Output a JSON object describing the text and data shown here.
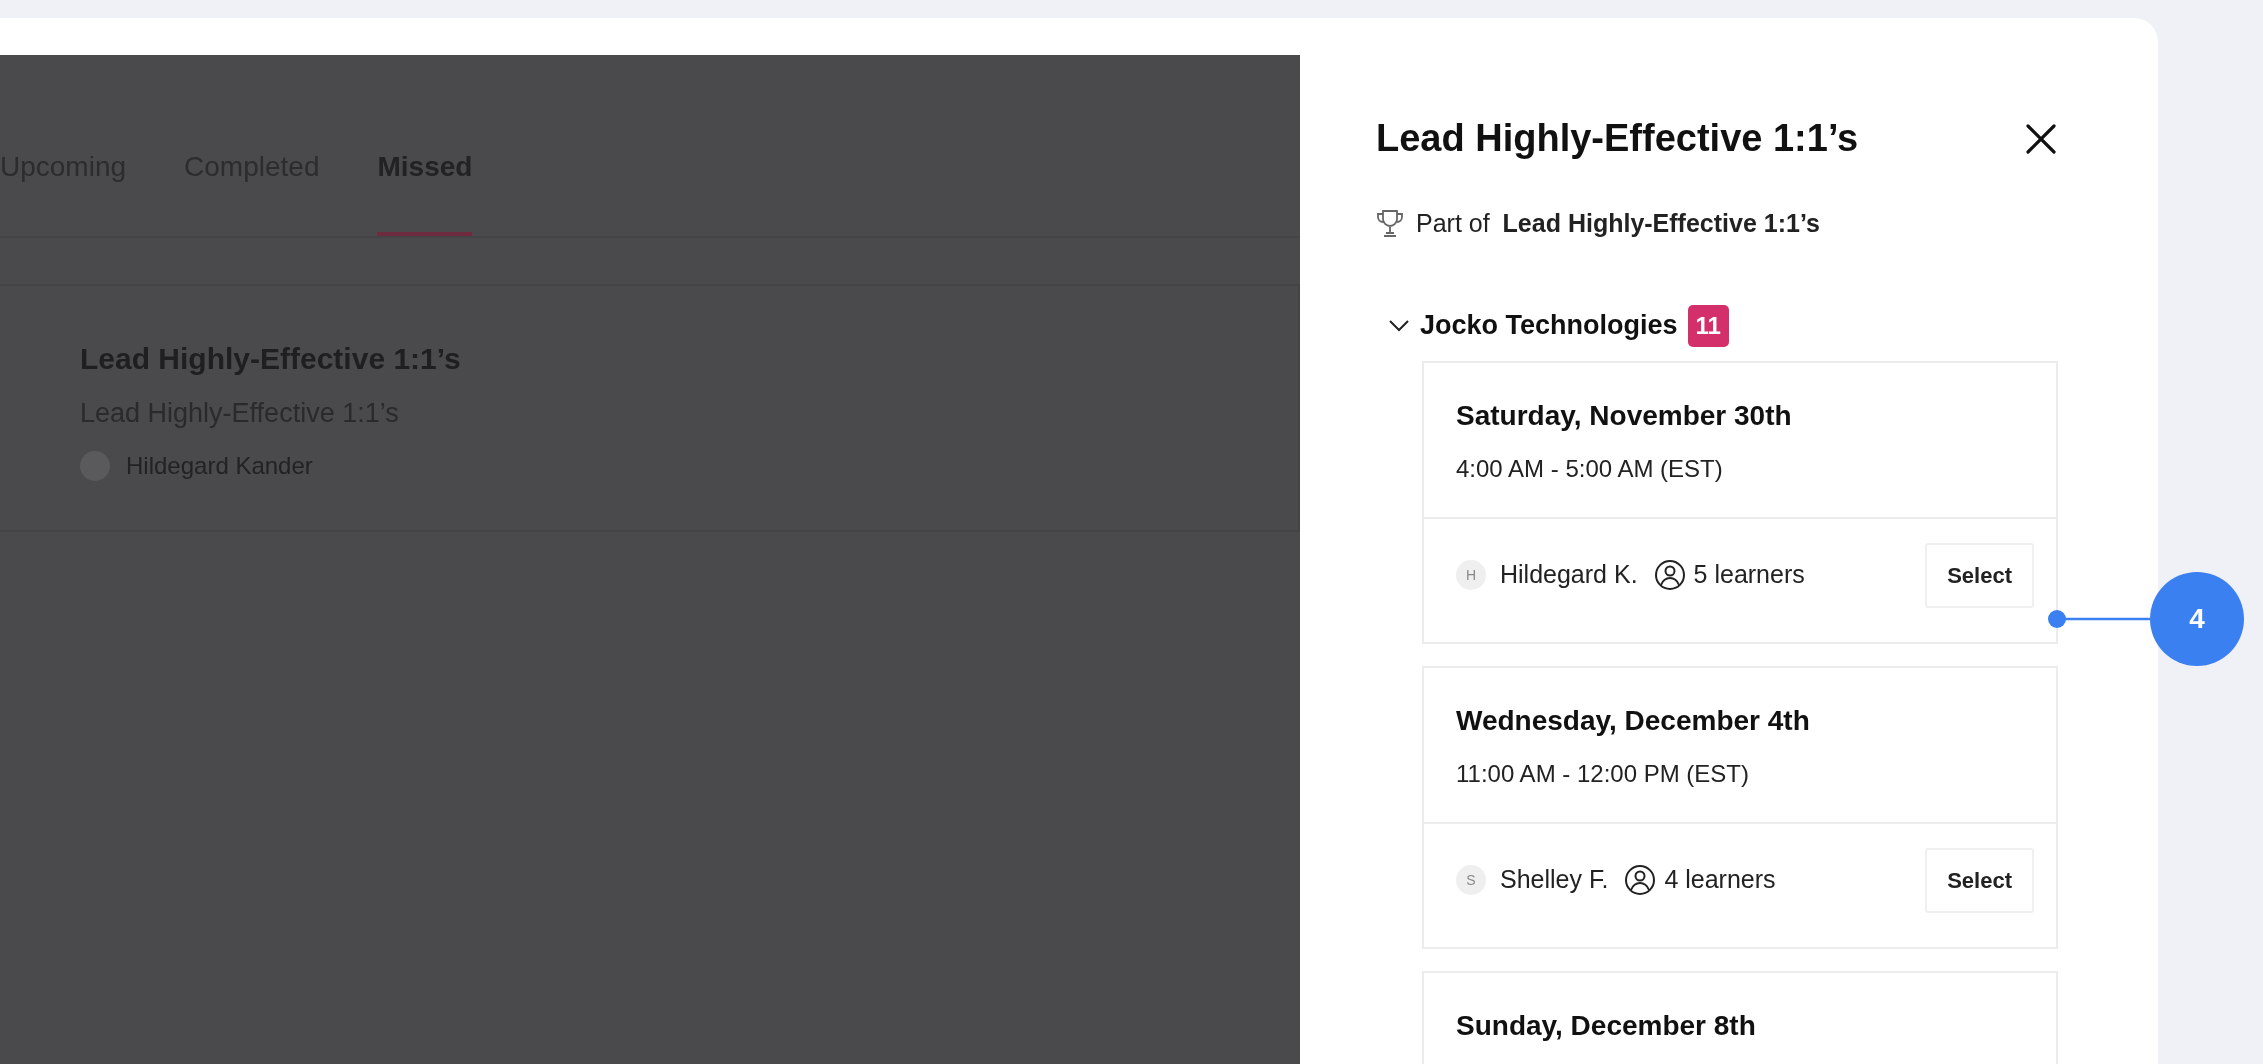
{
  "tabs": [
    {
      "label": "Upcoming",
      "selected": false
    },
    {
      "label": "Completed",
      "selected": false
    },
    {
      "label": "Missed",
      "selected": true
    }
  ],
  "missed_card": {
    "title": "Lead Highly-Effective 1:1’s",
    "subtitle": "Lead Highly-Effective 1:1’s",
    "facilitator": "Hildegard Kander"
  },
  "panel": {
    "title": "Lead Highly-Effective 1:1’s",
    "part_of_label": "Part of",
    "part_of_name": "Lead Highly-Effective 1:1’s",
    "groups": [
      {
        "name": "Jocko Technologies",
        "count": "11",
        "expanded": true,
        "sessions": [
          {
            "date": "Saturday, November 30th",
            "time": "4:00 AM - 5:00 AM (EST)",
            "initial": "H",
            "facilitator": "Hildegard K.",
            "learners": "5 learners",
            "button": "Select"
          },
          {
            "date": "Wednesday, December 4th",
            "time": "11:00 AM - 12:00 PM (EST)",
            "initial": "S",
            "facilitator": "Shelley F.",
            "learners": "4 learners",
            "button": "Select"
          },
          {
            "date": "Sunday, December 8th"
          }
        ]
      }
    ]
  },
  "annotation": {
    "number": "4"
  }
}
